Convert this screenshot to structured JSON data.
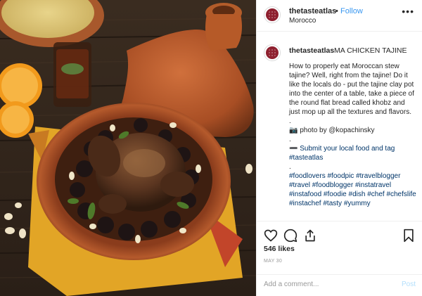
{
  "post": {
    "username": "thetasteatlas",
    "dot": "•",
    "follow_label": "Follow",
    "location": "Morocco",
    "more_icon": "more-dots-icon"
  },
  "caption": {
    "username": "thetasteatlas",
    "title": "MA CHICKEN TAJINE",
    "lines": [
      "How to properly eat Moroccan stew tajine? Well, right from the tajine! Do it like the locals do - put the tajine clay pot into the center of a table, take a piece of the round flat bread called khobz and just mop up all the textures and flavors.",
      ".",
      "📷 photo by @kopachinsky",
      ".",
      "➖ Submit your local food and tag #tasteatlas",
      ".",
      "#foodlovers #foodpic #travelblogger #travel #foodblogger #instatravel #instafood #foodie #dish #chef #chefslife #instachef #tasty #yummy"
    ]
  },
  "actions": {
    "like_icon": "heart-icon",
    "comment_icon": "comment-icon",
    "share_icon": "share-icon",
    "save_icon": "bookmark-icon"
  },
  "likes": "546 likes",
  "date": "MAY 30",
  "comment": {
    "placeholder": "Add a comment...",
    "post_label": "Post"
  },
  "colors": {
    "link": "#3897f0",
    "hashtag": "#003569",
    "post_disabled": "#b2dffc",
    "border": "#efefef"
  }
}
